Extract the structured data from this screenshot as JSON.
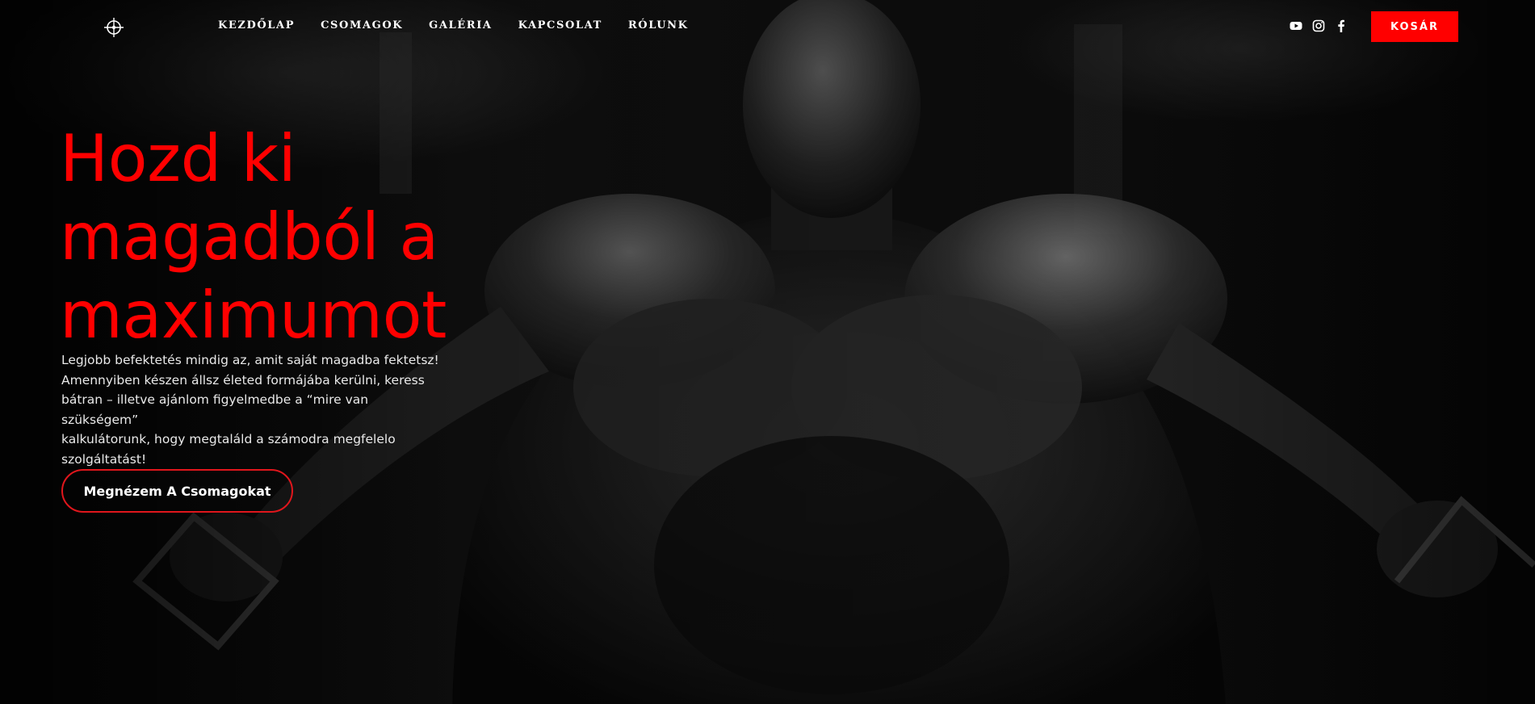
{
  "header": {
    "logo_icon": "compass-crosshair-logo-icon",
    "nav": [
      {
        "label": "KEZDŐLAP"
      },
      {
        "label": "CSOMAGOK"
      },
      {
        "label": "GALÉRIA"
      },
      {
        "label": "KAPCSOLAT"
      },
      {
        "label": "RÓLUNK"
      }
    ],
    "social_icons": [
      "youtube-icon",
      "instagram-icon",
      "facebook-icon"
    ],
    "cart_label": "KOSÁR"
  },
  "hero": {
    "title_lines": [
      "Hozd ki",
      "magadból a",
      "maximumot"
    ],
    "text_lines": [
      "Legjobb befektetés mindig az, amit saját magadba fektetsz!",
      "Amennyiben készen állsz életed formájába kerülni, keress",
      "bátran – illetve ajánlom figyelmedbe a “mire van szükségem”",
      "kalkulátorunk, hogy megtaláld a számodra megfelelo",
      "szolgáltatást!"
    ],
    "cta_label": "Megnézem A Csomagokat",
    "background": "grayscale-bodybuilder-photo"
  },
  "colors": {
    "accent": "#ff0000",
    "background": "#000000",
    "text": "#ffffff"
  }
}
